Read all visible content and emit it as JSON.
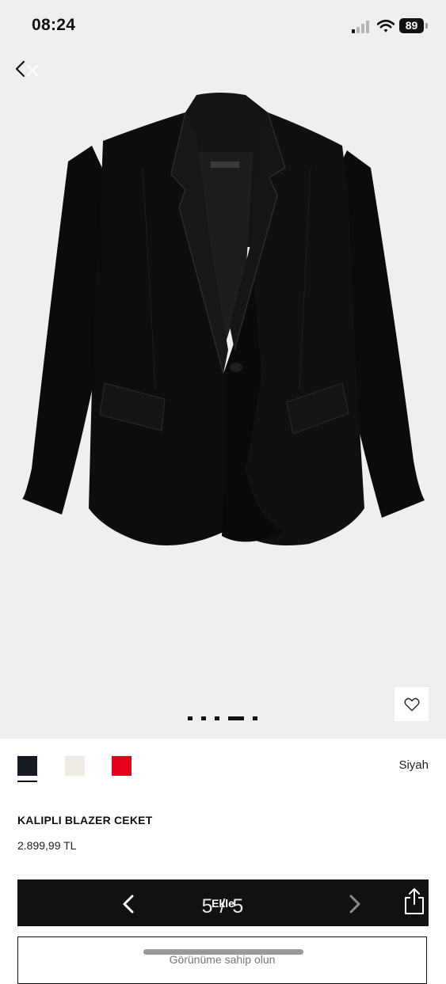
{
  "status_bar": {
    "time": "08:24",
    "battery": "89",
    "signal_icon": "cellular-signal-icon",
    "wifi_icon": "wifi-icon"
  },
  "gallery": {
    "back_icon": "back-chevron-icon",
    "image_description_icon": "product-photo",
    "wishlist_icon": "heart-icon",
    "background": "#efeff0"
  },
  "colors": {
    "selected_name": "Siyah",
    "swatches": [
      {
        "color": "#151a23"
      },
      {
        "color": "#efebe5"
      },
      {
        "color": "#e5001e"
      }
    ]
  },
  "product": {
    "title": "KALIPLI BLAZER CEKET",
    "price": "2.899,99 TL"
  },
  "actions": {
    "add_label": "Ekle",
    "counter": "5 / 5",
    "outline_label": "Görünüme sahip olun",
    "prev_icon": "chevron-left-icon",
    "next_icon": "chevron-right-icon",
    "share_icon": "share-icon"
  }
}
